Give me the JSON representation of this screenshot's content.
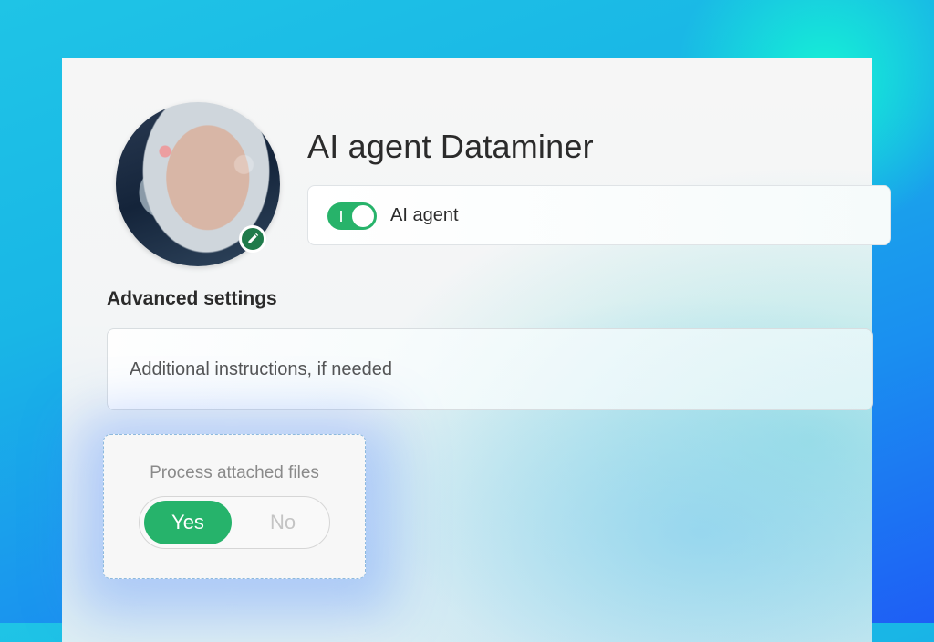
{
  "agent": {
    "name": "AI agent Dataminer",
    "toggle_label": "AI agent",
    "toggle_on": true,
    "avatar_icon": "avatar-portrait",
    "edit_icon": "pencil-icon"
  },
  "advanced": {
    "section_title": "Advanced settings",
    "instructions_placeholder": "Additional instructions, if needed"
  },
  "files": {
    "label": "Process attached files",
    "options": [
      "Yes",
      "No"
    ],
    "selected": "Yes"
  },
  "colors": {
    "accent_green": "#26b36b",
    "edit_badge_green": "#1f7a4a",
    "dashed_border": "#8db9de"
  }
}
